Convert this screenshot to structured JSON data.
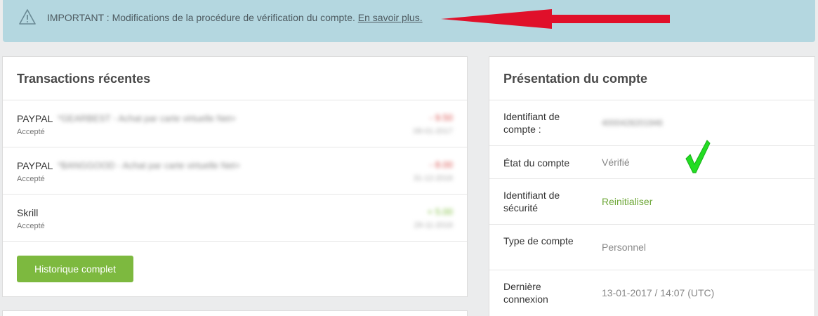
{
  "alert": {
    "prefix": "IMPORTANT : Modifications de la procédure de vérification du compte. ",
    "link": "En savoir plus."
  },
  "recent": {
    "title": "Transactions récentes",
    "items": [
      {
        "name": "PAYPAL",
        "desc": "*GEARBEST - Achat par carte virtuelle Net+",
        "status": "Accepté",
        "amount": "- 9.50",
        "amount_type": "negative",
        "date": "08-01-2017"
      },
      {
        "name": "PAYPAL",
        "desc": "*BANGGOOD - Achat par carte virtuelle Net+",
        "status": "Accepté",
        "amount": "- 8.00",
        "amount_type": "negative",
        "date": "31-12-2016"
      },
      {
        "name": "Skrill",
        "desc": "",
        "status": "Accepté",
        "amount": "+ 5.00",
        "amount_type": "positive",
        "date": "29-11-2016"
      }
    ],
    "history_button": "Historique complet"
  },
  "account": {
    "title": "Présentation du compte",
    "rows": [
      {
        "label": "Identifiant de compte :",
        "value": "4000428201946"
      },
      {
        "label": "État du compte",
        "value": "Vérifié"
      },
      {
        "label": "Identifiant de sécurité",
        "value": "Reinitialiser"
      },
      {
        "label": "Type de compte",
        "value": "Personnel"
      },
      {
        "label": "Dernière connexion",
        "value": "13-01-2017 / 14:07 (UTC)"
      }
    ]
  },
  "colors": {
    "alert_bg": "#b4d7e0",
    "accent_green": "#7db93f",
    "negative": "#d9534f",
    "annotation_red": "#e0102a",
    "check_green": "#22dd22"
  },
  "icons": [
    "warning-triangle-icon",
    "red-arrow-annotation",
    "green-check-annotation"
  ]
}
